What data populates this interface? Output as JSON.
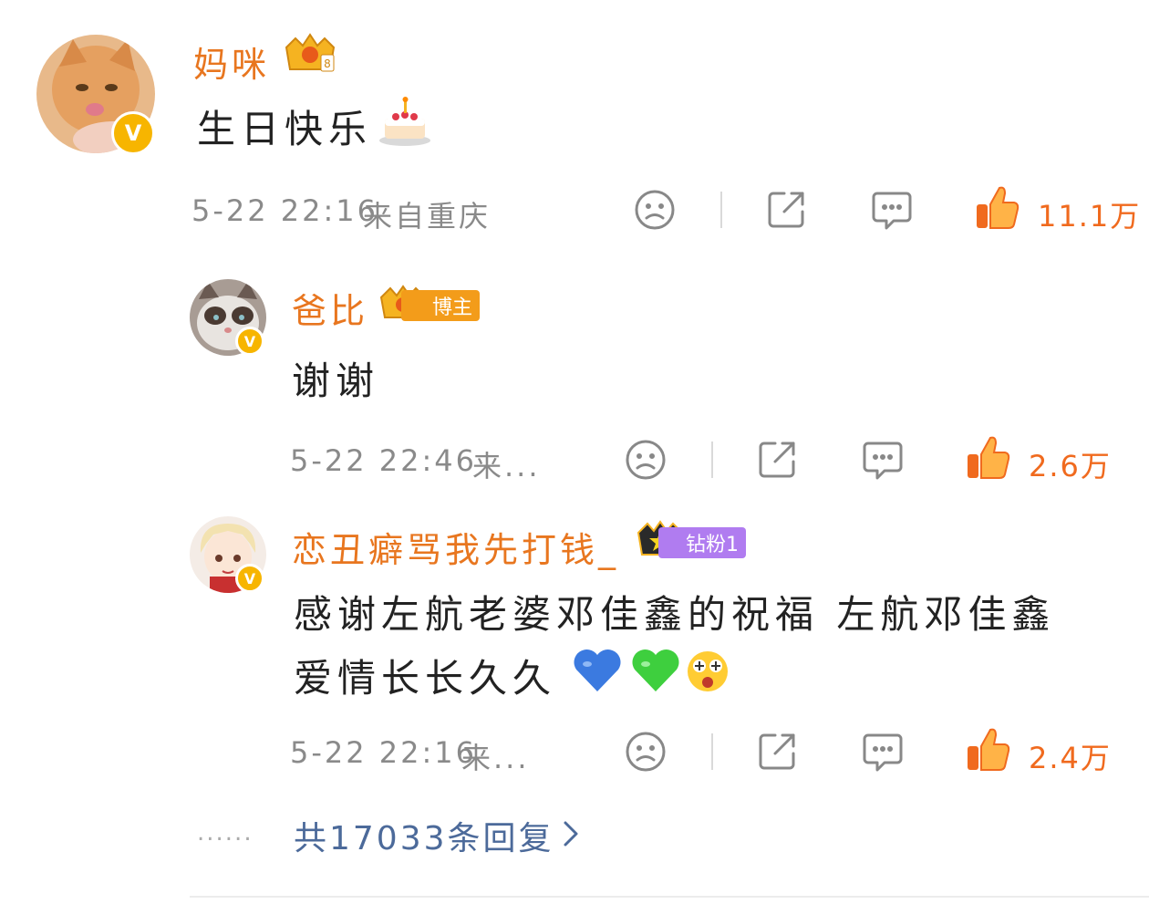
{
  "comment": {
    "username": "妈咪",
    "verified_badge": "V",
    "text": "生日快乐",
    "emoji": "cake-emoji",
    "time": "5-22 22:16",
    "location": "来自重庆",
    "likes": "11.1万"
  },
  "replies": [
    {
      "username": "爸比",
      "verified_badge": "V",
      "tag": "博主",
      "text": "谢谢",
      "time": "5-22 22:46",
      "location": "来...",
      "likes": "2.6万"
    },
    {
      "username": "恋丑癖骂我先打钱_",
      "verified_badge": "V",
      "tag": "钻粉1",
      "text_line1": "感谢左航老婆邓佳鑫的祝福 左航邓佳鑫",
      "text_line2": "爱情长长久久",
      "time": "5-22 22:16",
      "location": "来...",
      "likes": "2.4万"
    }
  ],
  "footer": {
    "dots": "......",
    "view_replies": "共17033条回复"
  },
  "colors": {
    "username": "#e8761f",
    "like": "#f06a1e",
    "meta": "#8a8a8a",
    "link": "#4c6a9a",
    "tag_blogger": "#f39c1a",
    "tag_fan": "#b07cf0"
  }
}
